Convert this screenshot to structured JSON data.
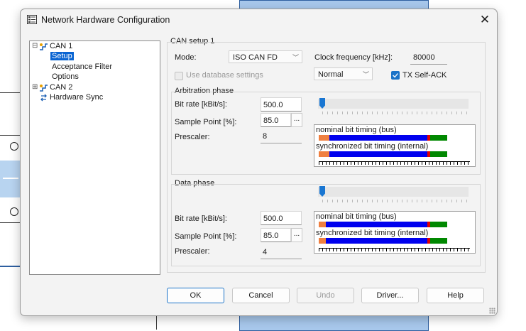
{
  "dialog": {
    "title": "Network Hardware Configuration",
    "close_label": "✕"
  },
  "tree": {
    "can1": "CAN 1",
    "setup": "Setup",
    "acceptance_filter": "Acceptance Filter",
    "options": "Options",
    "can2": "CAN 2",
    "hardware_sync": "Hardware Sync",
    "expander_collapse": "⊟",
    "expander_expand": "⊞"
  },
  "setup": {
    "group_title": "CAN setup 1",
    "mode_label": "Mode:",
    "mode_value": "ISO CAN FD",
    "clock_label": "Clock frequency [kHz]:",
    "clock_value": "80000",
    "use_db_label": "Use database settings",
    "use_db_checked": false,
    "output_mode_value": "Normal",
    "tx_self_ack_label": "TX Self-ACK",
    "tx_self_ack_checked": true
  },
  "arbitration": {
    "title": "Arbitration phase",
    "bitrate_label": "Bit rate [kBit/s]:",
    "bitrate_value": "500.0",
    "sample_point_label": "Sample Point [%]:",
    "sample_point_value": "85.0",
    "prescaler_label": "Prescaler:",
    "prescaler_value": "8",
    "nominal_label": "nominal bit timing (bus)",
    "sync_label": "synchronized bit timing (internal)",
    "slider_position": 0.0
  },
  "data_phase": {
    "title": "Data phase",
    "bitrate_label": "Bit rate [kBit/s]:",
    "bitrate_value": "500.0",
    "sample_point_label": "Sample Point [%]:",
    "sample_point_value": "85.0",
    "prescaler_label": "Prescaler:",
    "prescaler_value": "4",
    "nominal_label": "nominal bit timing (bus)",
    "sync_label": "synchronized bit timing (internal)",
    "slider_position": 0.0
  },
  "buttons": {
    "ok": "OK",
    "cancel": "Cancel",
    "undo": "Undo",
    "driver": "Driver...",
    "help": "Help",
    "dots": "..."
  },
  "timing_colors": {
    "sync": "#f08040",
    "prop": "#0000ee",
    "phase": "#008800",
    "sample": "#e00000"
  },
  "accent": "#1a73c8",
  "selection_color": "#0a64d2"
}
